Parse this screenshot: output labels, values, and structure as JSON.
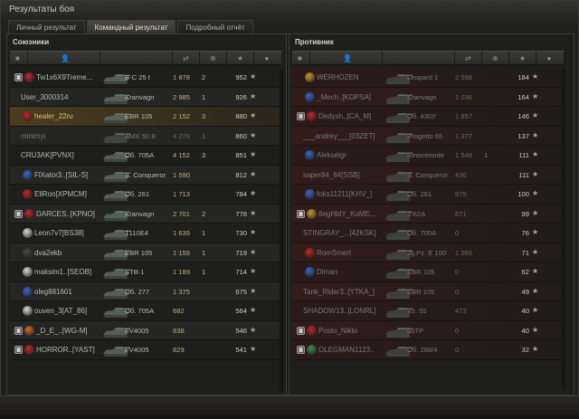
{
  "window": {
    "title": "Результаты боя"
  },
  "tabs": [
    {
      "label": "Личный результат",
      "active": false
    },
    {
      "label": "Командный результат",
      "active": true
    },
    {
      "label": "Подробный отчёт",
      "active": false
    }
  ],
  "allies": {
    "title": "Союзники",
    "rows": [
      {
        "platoon": true,
        "clan": "red",
        "name": "Tw1x6X9Treme...",
        "vehicle": "В-С 25 t",
        "damage": "1 878",
        "kills": "2",
        "xp": "952",
        "state": "alive"
      },
      {
        "platoon": false,
        "clan": "",
        "name": "User_3000314",
        "vehicle": "Kranvagn",
        "damage": "2 985",
        "kills": "1",
        "xp": "926",
        "state": "alive"
      },
      {
        "platoon": false,
        "clan": "red",
        "name": "healer_22ru",
        "vehicle": "EBR 105",
        "damage": "2 152",
        "kills": "3",
        "xp": "880",
        "state": "mine"
      },
      {
        "platoon": false,
        "clan": "",
        "name": "minimyi",
        "vehicle": "AMX 50 B",
        "damage": "4 276",
        "kills": "1",
        "xp": "860",
        "state": "dead"
      },
      {
        "platoon": false,
        "clan": "",
        "name": "CRU3AK[PVNX]",
        "vehicle": "Об. 705А",
        "damage": "4 152",
        "kills": "3",
        "xp": "851",
        "state": "alive"
      },
      {
        "platoon": false,
        "clan": "blue",
        "name": "FlXator3..[SIL-S]",
        "vehicle": "S. Conqueror",
        "damage": "1 590",
        "kills": "",
        "xp": "812",
        "state": "alive"
      },
      {
        "platoon": false,
        "clan": "red",
        "name": "EllRon[XPMCM]",
        "vehicle": "Об. 261",
        "damage": "1 713",
        "kills": "",
        "xp": "784",
        "state": "alive"
      },
      {
        "platoon": true,
        "clan": "red",
        "name": "DARCES..[KPNO]",
        "vehicle": "Kranvagn",
        "damage": "2 701",
        "kills": "2",
        "xp": "778",
        "state": "alive"
      },
      {
        "platoon": false,
        "clan": "white",
        "name": "Leon7v7[BS38]",
        "vehicle": "T110E4",
        "damage": "1 639",
        "kills": "1",
        "xp": "730",
        "state": "alive"
      },
      {
        "platoon": false,
        "clan": "dark",
        "name": "dva2ekb",
        "vehicle": "EBR 105",
        "damage": "1 159",
        "kills": "1",
        "xp": "719",
        "state": "alive"
      },
      {
        "platoon": false,
        "clan": "white",
        "name": "maksim1..[SEOB]",
        "vehicle": "STB-1",
        "damage": "1 189",
        "kills": "1",
        "xp": "714",
        "state": "alive"
      },
      {
        "platoon": false,
        "clan": "blue",
        "name": "oleg881601",
        "vehicle": "Об. 277",
        "damage": "1 375",
        "kills": "",
        "xp": "675",
        "state": "alive"
      },
      {
        "platoon": false,
        "clan": "white",
        "name": "ouven_3[AT_86]",
        "vehicle": "Об. 705А",
        "damage": "682",
        "kills": "",
        "xp": "564",
        "state": "alive"
      },
      {
        "platoon": true,
        "clan": "orange",
        "name": "_D_E_..[WG-M]",
        "vehicle": "FV4005",
        "damage": "838",
        "kills": "",
        "xp": "546",
        "state": "alive"
      },
      {
        "platoon": true,
        "clan": "red",
        "name": "HORROR..[YAST]",
        "vehicle": "FV4005",
        "damage": "829",
        "kills": "",
        "xp": "541",
        "state": "alive"
      }
    ]
  },
  "enemies": {
    "title": "Противник",
    "rows": [
      {
        "platoon": false,
        "clan": "gold",
        "name": "WERHOZEN",
        "vehicle": "Leopard 1",
        "damage": "2 598",
        "kills": "",
        "xp": "184",
        "state": "dead"
      },
      {
        "platoon": false,
        "clan": "blue",
        "name": "_Mech..[KDPSA]",
        "vehicle": "Kranvagn",
        "damage": "1 036",
        "kills": "",
        "xp": "164",
        "state": "dead"
      },
      {
        "platoon": true,
        "clan": "red",
        "name": "Dedysh..[CA_M]",
        "vehicle": "Об. 430У",
        "damage": "1 857",
        "kills": "",
        "xp": "146",
        "state": "dead"
      },
      {
        "platoon": false,
        "clan": "",
        "name": "___andrey___[03ZET]",
        "vehicle": "Progetto 65",
        "damage": "1 377",
        "kills": "",
        "xp": "137",
        "state": "dead"
      },
      {
        "platoon": false,
        "clan": "blue",
        "name": "Alekseigr",
        "vehicle": "Rinoceronte",
        "damage": "1 548",
        "kills": "1",
        "xp": "111",
        "state": "dead"
      },
      {
        "platoon": false,
        "clan": "",
        "name": "saper84_84[SSB]",
        "vehicle": "S. Conqueror",
        "damage": "430",
        "kills": "",
        "xp": "111",
        "state": "dead"
      },
      {
        "platoon": false,
        "clan": "blue",
        "name": "foks11211[KHV_]",
        "vehicle": "Об. 261",
        "damage": "879",
        "kills": "",
        "xp": "100",
        "state": "dead"
      },
      {
        "platoon": true,
        "clan": "gold",
        "name": "6egHblY_KoME...",
        "vehicle": "T-62A",
        "damage": "671",
        "kills": "",
        "xp": "99",
        "state": "dead"
      },
      {
        "platoon": false,
        "clan": "",
        "name": "STINGRAY_...[42KSK]",
        "vehicle": "Об. 705А",
        "damage": "0",
        "kills": "",
        "xp": "76",
        "state": "dead"
      },
      {
        "platoon": false,
        "clan": "red",
        "name": "RomSmert",
        "vehicle": "Jg.Pz. E 100",
        "damage": "1 065",
        "kills": "",
        "xp": "71",
        "state": "dead"
      },
      {
        "platoon": false,
        "clan": "blue",
        "name": "Diman",
        "vehicle": "EBR 105",
        "damage": "0",
        "kills": "",
        "xp": "62",
        "state": "dead"
      },
      {
        "platoon": false,
        "clan": "",
        "name": "Tank_Rider3..[YTKA_]",
        "vehicle": "EBR 105",
        "damage": "0",
        "kills": "",
        "xp": "49",
        "state": "dead"
      },
      {
        "platoon": false,
        "clan": "",
        "name": "SHADOW13..[LONRL]",
        "vehicle": "Vz. 55",
        "damage": "473",
        "kills": "",
        "xp": "40",
        "state": "dead"
      },
      {
        "platoon": true,
        "clan": "red",
        "name": "Posto_Nikto",
        "vehicle": "60TP",
        "damage": "0",
        "kills": "",
        "xp": "40",
        "state": "dead"
      },
      {
        "platoon": true,
        "clan": "green",
        "name": "OLEGMAN1123..",
        "vehicle": "Об. 268/4",
        "damage": "0",
        "kills": "",
        "xp": "32",
        "state": "dead"
      }
    ]
  },
  "icons": {
    "platoon": "platoon-icon",
    "star": "star-icon",
    "tank": "tank-silhouette-icon"
  },
  "colors": {
    "red": "#c0282a",
    "blue": "#3b67c4",
    "gold": "#c99a2b",
    "white": "#d9d9d9",
    "orange": "#d0692b",
    "dark": "#4a4a4a",
    "green": "#3f8c4a",
    "damage": "#c3b07a"
  }
}
